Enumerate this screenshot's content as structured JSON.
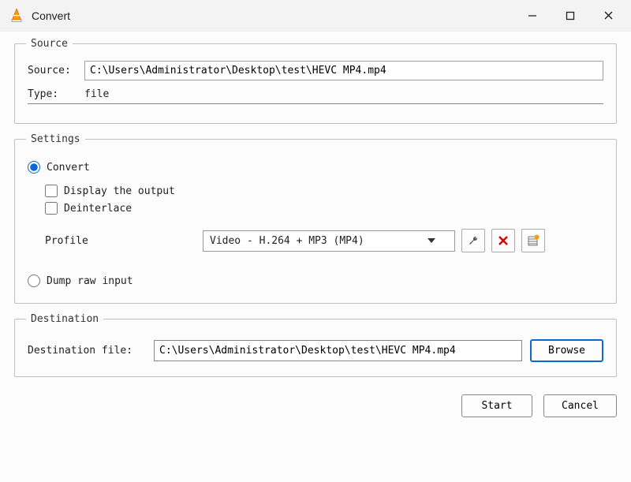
{
  "window": {
    "title": "Convert"
  },
  "source": {
    "legend": "Source",
    "source_label": "Source:",
    "source_value": "C:\\Users\\Administrator\\Desktop\\test\\HEVC MP4.mp4",
    "type_label": "Type:",
    "type_value": "file"
  },
  "settings": {
    "legend": "Settings",
    "convert_label": "Convert",
    "display_output_label": "Display the output",
    "deinterlace_label": "Deinterlace",
    "profile_label": "Profile",
    "profile_value": "Video - H.264 + MP3 (MP4)",
    "dump_raw_label": "Dump raw input"
  },
  "destination": {
    "legend": "Destination",
    "dest_label": "Destination file:",
    "dest_value": "C:\\Users\\Administrator\\Desktop\\test\\HEVC MP4.mp4",
    "browse_label": "Browse"
  },
  "buttons": {
    "start": "Start",
    "cancel": "Cancel"
  }
}
